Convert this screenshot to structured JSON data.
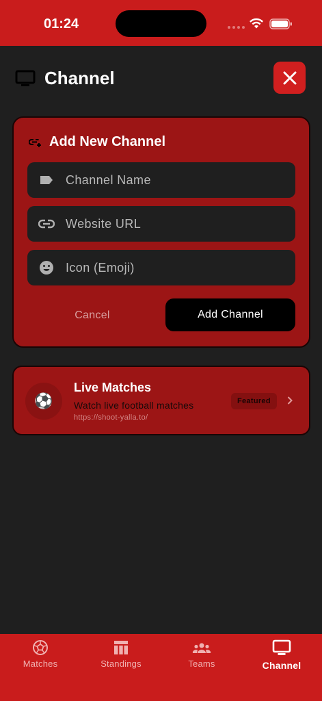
{
  "status_bar": {
    "time": "01:24"
  },
  "header": {
    "title": "Channel",
    "icon": "tv-icon",
    "close_icon": "close-icon"
  },
  "add_channel_form": {
    "title": "Add New Channel",
    "fields": [
      {
        "placeholder": "Channel Name",
        "value": "",
        "icon": "tag-icon"
      },
      {
        "placeholder": "Website URL",
        "value": "",
        "icon": "link-icon"
      },
      {
        "placeholder": "Icon (Emoji)",
        "value": "",
        "icon": "emoji-icon"
      }
    ],
    "cancel_label": "Cancel",
    "submit_label": "Add Channel"
  },
  "channels": [
    {
      "emoji": "⚽",
      "name": "Live Matches",
      "description": "Watch live football matches",
      "url": "https://shoot-yalla.to/",
      "badge": "Featured"
    }
  ],
  "tabs": [
    {
      "label": "Matches",
      "icon": "soccer-ball-icon",
      "active": false
    },
    {
      "label": "Standings",
      "icon": "table-icon",
      "active": false
    },
    {
      "label": "Teams",
      "icon": "people-icon",
      "active": false
    },
    {
      "label": "Channel",
      "icon": "tv-icon",
      "active": true
    }
  ],
  "colors": {
    "accent": "#c91c1c",
    "card": "#9c1515",
    "background": "#1f1f1f"
  }
}
